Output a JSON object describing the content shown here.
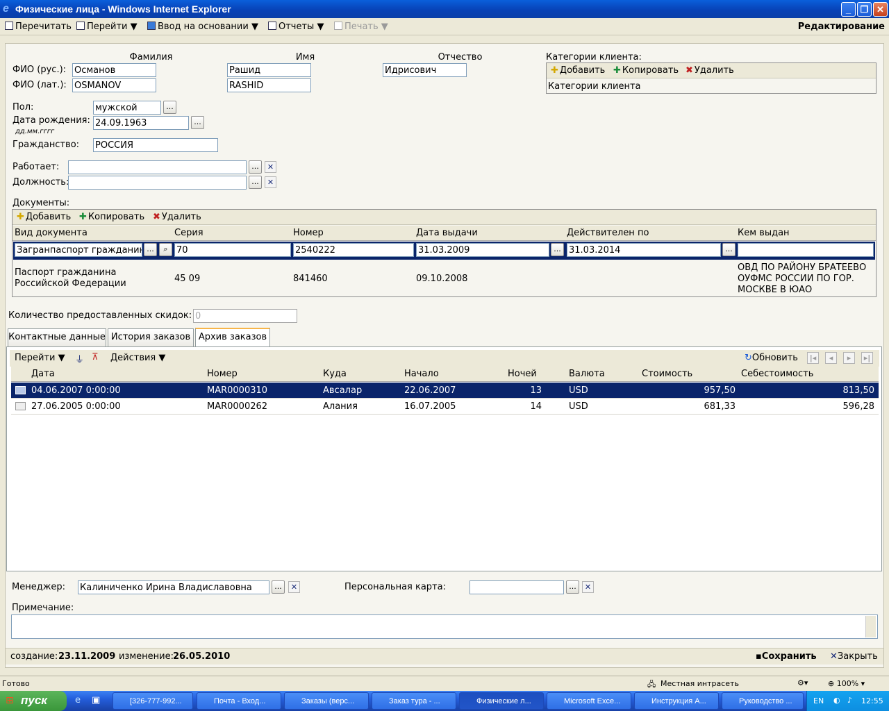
{
  "window": {
    "title": "Физические лица - Windows Internet Explorer"
  },
  "toolbar": {
    "reread": "Перечитать",
    "goto": "Перейти ▼",
    "input_basis": "Ввод на основании ▼",
    "reports": "Отчеты ▼",
    "print": "Печать ▼",
    "mode": "Редактирование"
  },
  "name_headers": {
    "last": "Фамилия",
    "first": "Имя",
    "middle": "Отчество"
  },
  "fio_rus": {
    "label": "ФИО (рус.):",
    "last": "Османов",
    "first": "Рашид",
    "middle": "Идрисович"
  },
  "fio_lat": {
    "label": "ФИО (лат.):",
    "last": "OSMANOV",
    "first": "RASHID"
  },
  "client_categories": {
    "label": "Категории клиента:",
    "add": "Добавить",
    "copy": "Копировать",
    "delete": "Удалить",
    "column": "Категории клиента"
  },
  "gender": {
    "label": "Пол:",
    "value": "мужской"
  },
  "birth": {
    "label": "Дата рождения:",
    "hint": "дд.мм.гггг",
    "value": "24.09.1963"
  },
  "citizenship": {
    "label": "Гражданство:",
    "value": "РОССИЯ"
  },
  "works": {
    "label": "Работает:",
    "value": ""
  },
  "position": {
    "label": "Должность:",
    "value": ""
  },
  "documents": {
    "label": "Документы:",
    "add": "Добавить",
    "copy": "Копировать",
    "delete": "Удалить",
    "columns": [
      "Вид документа",
      "Серия",
      "Номер",
      "Дата выдачи",
      "Действителен по",
      "Кем выдан"
    ],
    "edit_row": {
      "type": "Загранпаспорт гражданин",
      "series": "70",
      "number": "2540222",
      "issued": "31.03.2009",
      "valid": "31.03.2014",
      "issuer": ""
    },
    "row2": {
      "type_line1": "Паспорт гражданина",
      "type_line2": "Российской Федерации",
      "series": "45 09",
      "number": "841460",
      "issued": "09.10.2008",
      "issuer_line1": "ОВД ПО РАЙОНУ БРАТЕЕВО",
      "issuer_line2": "ОУФМС РОССИИ ПО ГОР.",
      "issuer_line3": "МОСКВЕ В ЮАО"
    }
  },
  "discounts": {
    "label": "Количество предоставленных скидок:",
    "value": "0"
  },
  "tabs": [
    "Контактные данные",
    "История заказов",
    "Архив заказов"
  ],
  "orders": {
    "goto": "Перейти ▼",
    "actions": "Действия ▼",
    "refresh": "Обновить",
    "columns": [
      "Дата",
      "Номер",
      "Куда",
      "Начало",
      "Ночей",
      "Валюта",
      "Стоимость",
      "Себестоимость"
    ],
    "rows": [
      {
        "date": "04.06.2007 0:00:00",
        "number": "MAR0000310",
        "dest": "Авсалар",
        "start": "22.06.2007",
        "nights": "13",
        "currency": "USD",
        "cost": "957,50",
        "selfcost": "813,50"
      },
      {
        "date": "27.06.2005 0:00:00",
        "number": "MAR0000262",
        "dest": "Алания",
        "start": "16.07.2005",
        "nights": "14",
        "currency": "USD",
        "cost": "681,33",
        "selfcost": "596,28"
      }
    ]
  },
  "manager": {
    "label": "Менеджер:",
    "value": "Калиниченко Ирина Владиславовна"
  },
  "card": {
    "label": "Персональная карта:",
    "value": ""
  },
  "note": {
    "label": "Примечание:",
    "value": ""
  },
  "footer": {
    "created_label": "создание:",
    "created": "23.11.2009",
    "changed_label": "изменение:",
    "changed": "26.05.2010",
    "save": "Сохранить",
    "close": "Закрыть"
  },
  "status": {
    "text": "Готово",
    "zone": "Местная интрасеть",
    "zoom": "100%"
  },
  "taskbar": {
    "start": "пуск",
    "tasks": [
      "[326-777-992...",
      "Почта - Вход...",
      "Заказы (верс...",
      "Заказ тура - ...",
      "Физические л...",
      "Microsoft Exce...",
      "Инструкция А...",
      "Руководство ..."
    ],
    "lang": "EN",
    "clock": "12:55"
  }
}
